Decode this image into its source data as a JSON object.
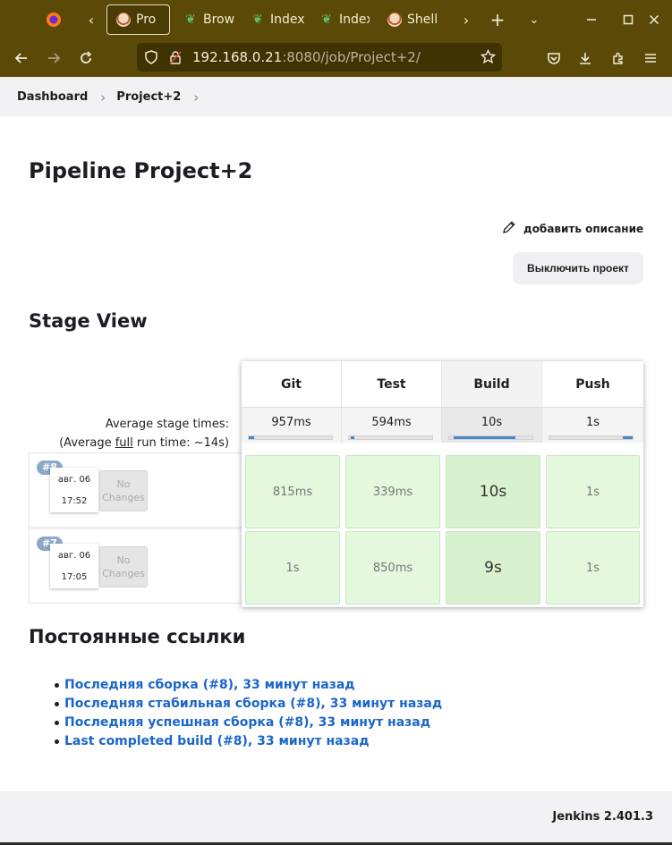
{
  "browser": {
    "tabs": [
      {
        "label": "Pro",
        "icon": "jenkins-icon",
        "active": true
      },
      {
        "label": "Brow",
        "icon": "leaf-icon"
      },
      {
        "label": "Index",
        "icon": "leaf-icon"
      },
      {
        "label": "Index",
        "icon": "leaf-icon"
      },
      {
        "label": "Shell",
        "icon": "jenkins-icon"
      }
    ],
    "url_host": "192.168.0.21",
    "url_rest": ":8080/job/Project+2/"
  },
  "breadcrumb": {
    "items": [
      "Dashboard",
      "Project+2"
    ]
  },
  "page": {
    "title": "Pipeline Project+2",
    "add_description": "добавить описание",
    "disable_button": "Выключить проект"
  },
  "stage_view": {
    "title": "Stage View",
    "avg_label_line1": "Average stage times:",
    "avg_label_line2_prefix": "(Average ",
    "avg_label_full": "full",
    "avg_label_line2_suffix": " run time: ~14s)",
    "stages": [
      {
        "name": "Git",
        "avg": "957ms",
        "fill_fraction": 0.06,
        "fill_offset": 0.0
      },
      {
        "name": "Test",
        "avg": "594ms",
        "fill_fraction": 0.04,
        "fill_offset": 0.02
      },
      {
        "name": "Build",
        "avg": "10s",
        "fill_fraction": 0.74,
        "fill_offset": 0.05
      },
      {
        "name": "Push",
        "avg": "1s",
        "fill_fraction": 0.12,
        "fill_offset": 0.88
      }
    ],
    "runs": [
      {
        "badge": "#8",
        "date": "авг. 06",
        "time": "17:52",
        "changes": "No Changes",
        "durations": [
          "815ms",
          "339ms",
          "10s",
          "1s"
        ]
      },
      {
        "badge": "#7",
        "date": "авг. 06",
        "time": "17:05",
        "changes": "No Changes",
        "durations": [
          "1s",
          "850ms",
          "9s",
          "1s"
        ]
      }
    ]
  },
  "permalinks": {
    "title": "Постоянные ссылки",
    "items": [
      "Последняя сборка (#8), 33 минут назад",
      "Последняя стабильная сборка (#8), 33 минут назад",
      "Последняя успешная сборка (#8), 33 минут назад",
      "Last completed build (#8), 33 минут назад"
    ]
  },
  "footer": {
    "version": "Jenkins 2.401.3"
  }
}
